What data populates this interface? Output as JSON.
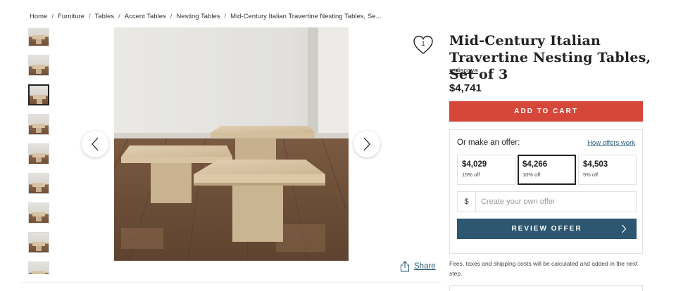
{
  "breadcrumb": [
    {
      "label": "Home"
    },
    {
      "label": "Furniture"
    },
    {
      "label": "Tables"
    },
    {
      "label": "Accent Tables"
    },
    {
      "label": "Nesting Tables"
    },
    {
      "label": "Mid-Century Italian Travertine Nesting Tables, Se..."
    }
  ],
  "breadcrumb_separator": "/",
  "gallery": {
    "thumbnail_count": 9,
    "active_thumbnail_index": 2
  },
  "favorite": {
    "count": "1"
  },
  "product": {
    "title": "Mid-Century Italian Travertine Nesting Tables, Set of 3",
    "seller": "rediscova",
    "price": "$4,741"
  },
  "cart": {
    "add_label": "ADD TO CART"
  },
  "offer": {
    "heading": "Or make an offer:",
    "how_link": "How offers work",
    "options": [
      {
        "amount": "$4,029",
        "discount": "15% off"
      },
      {
        "amount": "$4,266",
        "discount": "10% off"
      },
      {
        "amount": "$4,503",
        "discount": "5% off"
      }
    ],
    "selected_index": 1,
    "currency_symbol": "$",
    "custom_placeholder": "Create your own offer",
    "custom_value": "",
    "review_label": "REVIEW OFFER"
  },
  "share": {
    "label": "Share"
  },
  "fees_note": "Fees, taxes and shipping costs will be calculated and added in the next step.",
  "colors": {
    "accent_red": "#d6473a",
    "review_blue": "#2d5670",
    "link_blue": "#2d5d7b"
  },
  "icons": {
    "prev": "chevron-left-icon",
    "next": "chevron-right-icon",
    "favorite": "heart-icon",
    "share": "share-icon"
  }
}
